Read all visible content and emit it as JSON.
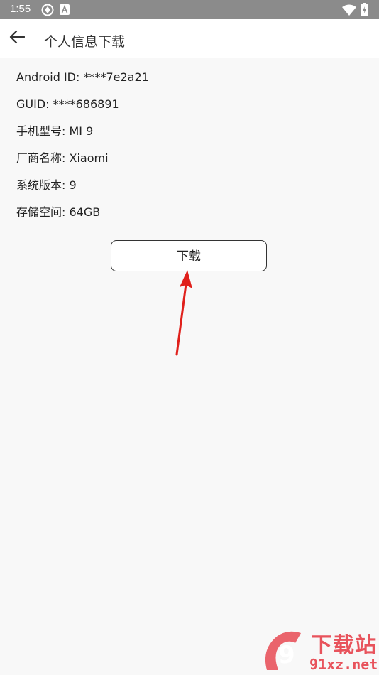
{
  "status_bar": {
    "time": "1:55",
    "icons_left": [
      "sync-icon",
      "a-letter-icon"
    ],
    "icons_right": [
      "wifi-icon",
      "battery-icon"
    ]
  },
  "app_bar": {
    "back_icon": "arrow-left-icon",
    "title": "个人信息下载"
  },
  "info": [
    {
      "text": "Android ID: ****7e2a21"
    },
    {
      "text": "GUID: ****686891"
    },
    {
      "text": "手机型号: MI 9"
    },
    {
      "text": "厂商名称: Xiaomi"
    },
    {
      "text": "系统版本: 9"
    },
    {
      "text": "存储空间: 64GB"
    }
  ],
  "download_button": {
    "label": "下载"
  },
  "annotation": {
    "arrow_color": "#e0201b"
  },
  "watermark": {
    "logo_glyph": "9",
    "top_text": "下载站",
    "bottom_text": "91xz.net",
    "color": "#e8535c"
  }
}
